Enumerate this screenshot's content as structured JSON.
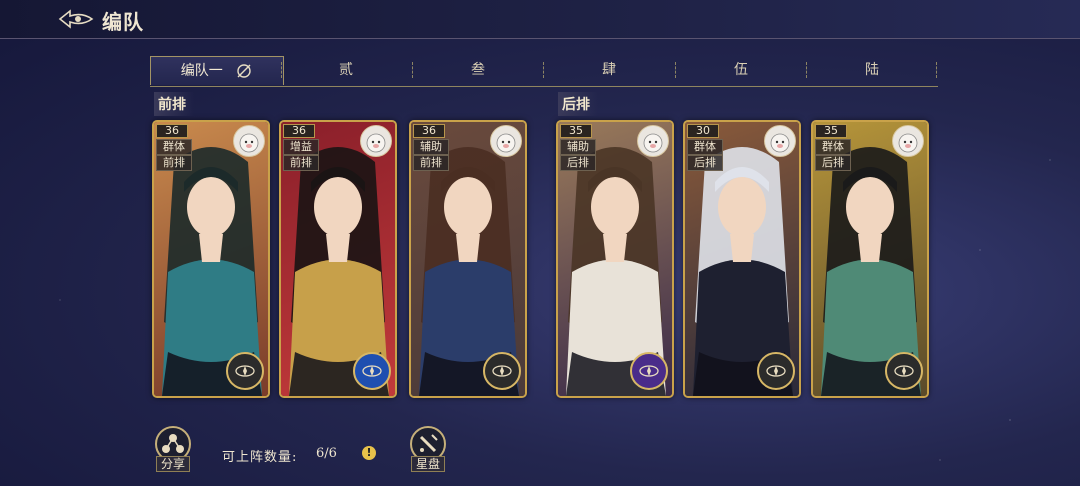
{
  "header": {
    "title": "编队"
  },
  "tabs": [
    {
      "label": "编队一",
      "active": true
    },
    {
      "label": "贰"
    },
    {
      "label": "叁"
    },
    {
      "label": "肆"
    },
    {
      "label": "伍"
    },
    {
      "label": "陆"
    }
  ],
  "rows": {
    "front": "前排",
    "back": "后排"
  },
  "cards": [
    {
      "level": "36",
      "tag1": "群体",
      "tag2": "前排",
      "avatar_icon": "bird-avatar-icon",
      "emblem_color": "#2b2b2b",
      "bg": [
        "#c98a4d",
        "#7a3b2a"
      ],
      "hair": "#1c2a2a",
      "robe": "#2f7c85"
    },
    {
      "level": "36",
      "tag1": "增益",
      "tag2": "前排",
      "avatar_icon": "dragon-avatar-icon",
      "emblem_color": "#1f4fb0",
      "bg": [
        "#8a1f2a",
        "#c23a3a"
      ],
      "hair": "#1a1414",
      "robe": "#c7a04a"
    },
    {
      "level": "36",
      "tag1": "辅助",
      "tag2": "前排",
      "avatar_icon": "pig-avatar-icon",
      "emblem_color": "#2b2b2b",
      "bg": [
        "#6a4a3c",
        "#4a3a3a"
      ],
      "hair": "#4a2e22",
      "robe": "#2b3d6a"
    },
    {
      "level": "35",
      "tag1": "辅助",
      "tag2": "后排",
      "avatar_icon": "pig-avatar-icon",
      "emblem_color": "#4a2c8a",
      "bg": [
        "#9a7a5a",
        "#3a2a4a"
      ],
      "hair": "#4a3526",
      "robe": "#e8e2d8"
    },
    {
      "level": "30",
      "tag1": "群体",
      "tag2": "后排",
      "avatar_icon": "rabbit-avatar-icon",
      "emblem_color": "#2b2b2b",
      "bg": [
        "#8a5a3a",
        "#2a2a3a"
      ],
      "hair": "#dfe2ea",
      "robe": "#1e2030"
    },
    {
      "level": "35",
      "tag1": "群体",
      "tag2": "后排",
      "avatar_icon": "sheep-avatar-icon",
      "emblem_color": "#2b2b2b",
      "bg": [
        "#b6953a",
        "#5a4a2a"
      ],
      "hair": "#1a1a1a",
      "robe": "#4f8a76"
    }
  ],
  "bottom": {
    "share_label": "分享",
    "count_label": "可上阵数量:",
    "count_value": "6/6",
    "starmap_label": "星盘"
  },
  "colors": {
    "accent_gold": "#c9a24a",
    "warning": "#e8c24a"
  }
}
